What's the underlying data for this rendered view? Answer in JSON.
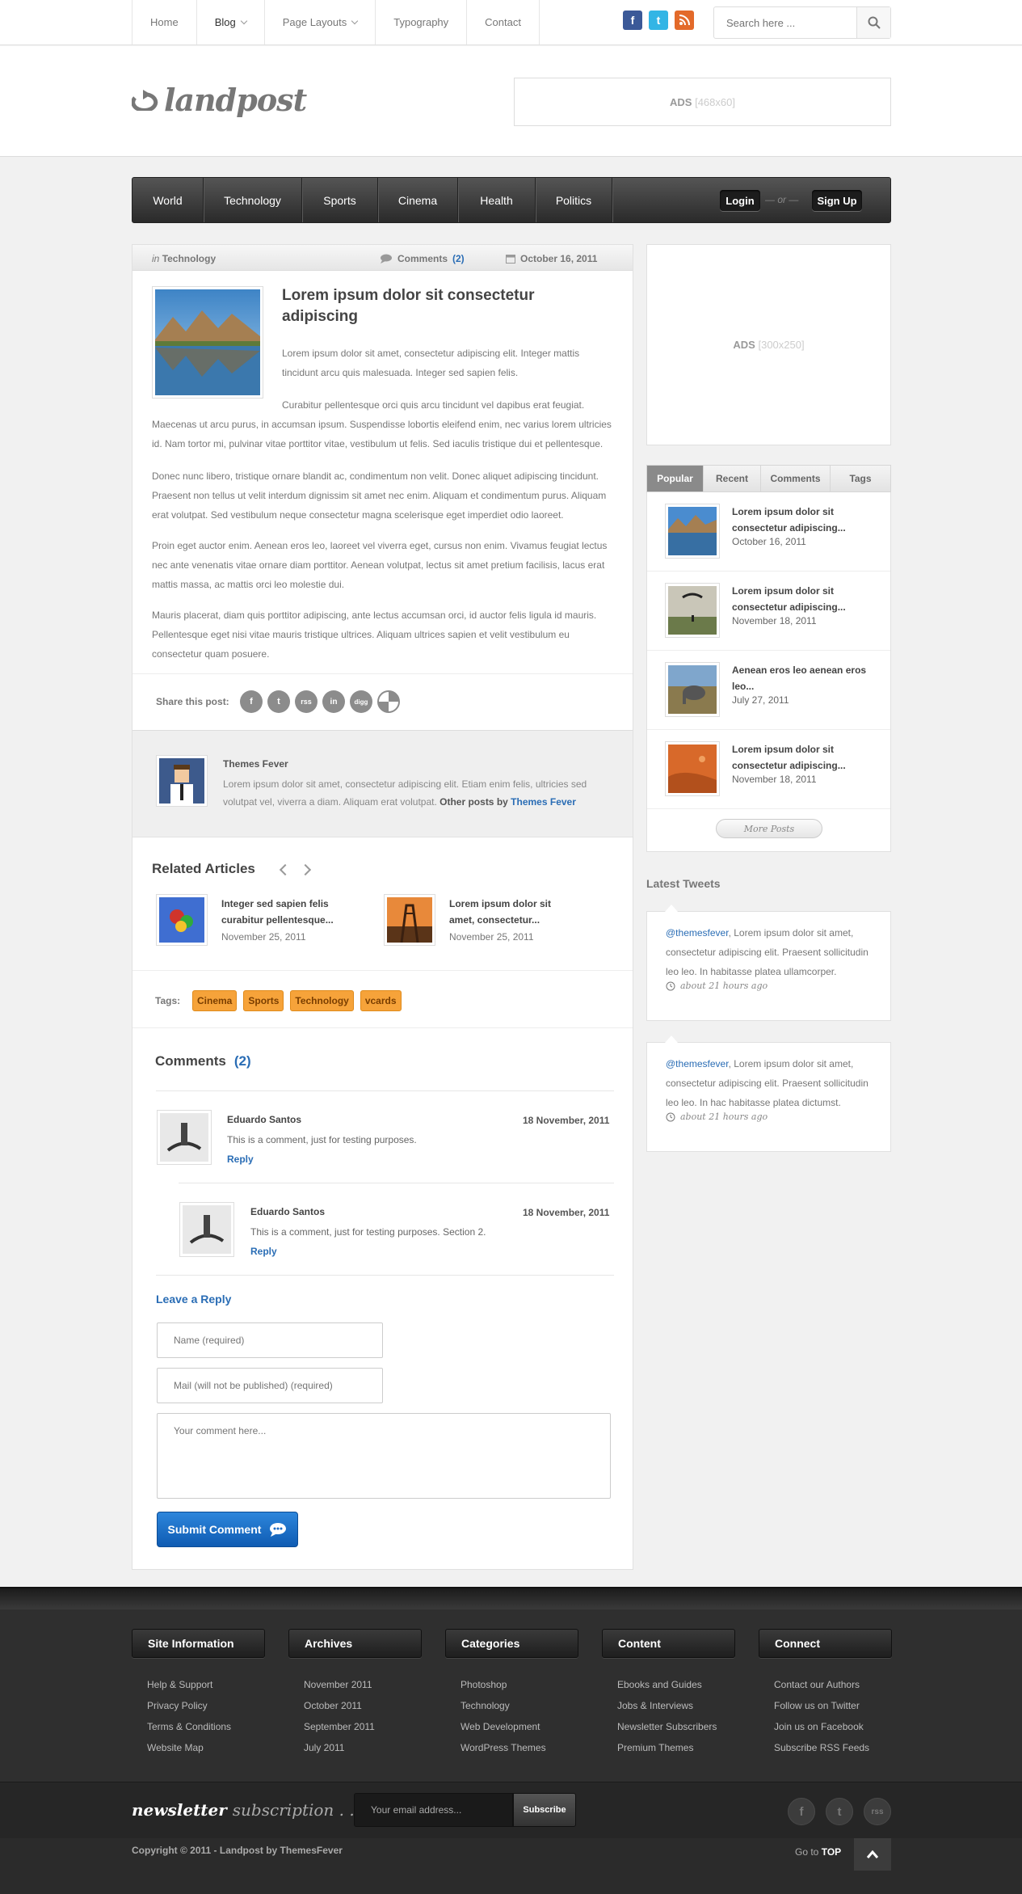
{
  "topnav": {
    "items": [
      "Home",
      "Blog",
      "Page Layouts",
      "Typography",
      "Contact"
    ],
    "social": [
      "facebook-icon",
      "twitter-icon",
      "rss-icon"
    ],
    "search_placeholder": "Search here ..."
  },
  "header": {
    "logo_text": "landpost",
    "ads_label": "ADS",
    "ads_size": "[468x60]"
  },
  "mainnav": {
    "items": [
      "World",
      "Technology",
      "Sports",
      "Cinema",
      "Health",
      "Politics"
    ],
    "login": "Login",
    "or": "— or —",
    "signup": "Sign Up"
  },
  "post": {
    "in_label": "in",
    "category": "Technology",
    "comments_label": "Comments",
    "comments_count": "(2)",
    "date": "October 16, 2011",
    "title": "Lorem ipsum dolor sit consectetur adipiscing",
    "intro": "Lorem ipsum dolor sit amet, consectetur adipiscing elit. Integer mattis tincidunt arcu quis malesuada. Integer sed sapien felis.",
    "p1_first": "Curabitur pellentesque orci quis arcu tincidunt vel dapibus erat feugiat.",
    "p1_rest": "Maecenas ut arcu purus, in accumsan ipsum. Suspendisse lobortis eleifend enim, nec varius lorem ultricies id. Nam tortor mi, pulvinar vitae porttitor vitae, vestibulum ut felis. Sed iaculis tristique dui et pellentesque.",
    "p2": "Donec nunc libero, tristique ornare blandit ac, condimentum non velit. Donec aliquet adipiscing tincidunt. Praesent non tellus ut velit interdum dignissim sit amet nec enim. Aliquam et condimentum purus. Aliquam erat volutpat. Sed vestibulum neque consectetur magna scelerisque eget imperdiet odio laoreet.",
    "p3": "Proin eget auctor enim. Aenean eros leo, laoreet vel viverra eget, cursus non enim. Vivamus feugiat lectus nec ante venenatis vitae ornare diam porttitor. Aenean volutpat, lectus sit amet pretium facilisis, lacus erat mattis massa, ac mattis orci leo molestie dui.",
    "p4": "Mauris placerat, diam quis porttitor adipiscing, ante lectus accumsan orci, id auctor felis ligula id mauris. Pellentesque eget nisi vitae mauris tristique ultrices. Aliquam ultrices sapien et velit vestibulum eu consectetur quam posuere.",
    "share_label": "Share this post:",
    "share_icons": [
      "f",
      "t",
      "rss",
      "in",
      "digg",
      "del"
    ]
  },
  "author": {
    "name": "Themes Fever",
    "bio": "Lorem ipsum dolor sit amet, consectetur adipiscing elit. Etiam enim felis, ultricies sed volutpat vel, viverra a diam. Aliquam erat volutpat.",
    "other_posts": "Other posts by",
    "link": "Themes Fever"
  },
  "related": {
    "title": "Related Articles",
    "items": [
      {
        "title": "Integer sed sapien felis curabitur pellentesque...",
        "date": "November 25, 2011"
      },
      {
        "title": "Lorem ipsum dolor sit amet, consectetur...",
        "date": "November 25, 2011"
      }
    ]
  },
  "tags": {
    "label": "Tags:",
    "items": [
      "Cinema",
      "Sports",
      "Technology",
      "vcards"
    ]
  },
  "comments": {
    "title": "Comments",
    "count": "(2)",
    "items": [
      {
        "name": "Eduardo Santos",
        "date": "18 November, 2011",
        "text": "This is a comment, just for testing purposes.",
        "reply": "Reply"
      },
      {
        "name": "Eduardo Santos",
        "date": "18 November, 2011",
        "text": "This is a comment, just for testing purposes. Section 2.",
        "reply": "Reply"
      }
    ]
  },
  "reply_form": {
    "title": "Leave a Reply",
    "name_placeholder": "Name (required)",
    "mail_placeholder": "Mail (will not be published) (required)",
    "comment_placeholder": "Your comment here...",
    "submit": "Submit Comment"
  },
  "sidebar": {
    "ads_label": "ADS",
    "ads_size": "[300x250]",
    "tabs": [
      "Popular",
      "Recent",
      "Comments",
      "Tags"
    ],
    "posts": [
      {
        "title": "Lorem ipsum dolor sit consectetur adipiscing...",
        "date": "October 16, 2011"
      },
      {
        "title": "Lorem ipsum dolor sit consectetur adipiscing...",
        "date": "November 18, 2011"
      },
      {
        "title": "Aenean eros leo aenean eros leo...",
        "date": "July 27, 2011"
      },
      {
        "title": "Lorem ipsum dolor sit consectetur adipiscing...",
        "date": "November 18, 2011"
      }
    ],
    "more": "More Posts",
    "tweets_title": "Latest Tweets",
    "tweets": [
      {
        "handle": "@themesfever",
        "text": ", Lorem ipsum dolor sit amet, consectetur adipiscing elit. Praesent sollicitudin leo leo. In habitasse platea ullamcorper.",
        "time": "about 21 hours ago"
      },
      {
        "handle": "@themesfever",
        "text": ", Lorem ipsum dolor sit amet, consectetur adipiscing elit. Praesent sollicitudin leo leo. In hac habitasse platea dictumst.",
        "time": "about 21 hours ago"
      }
    ]
  },
  "footer": {
    "cols": [
      {
        "title": "Site Information",
        "links": [
          "Help & Support",
          "Privacy Policy",
          "Terms & Conditions",
          "Website Map"
        ]
      },
      {
        "title": "Archives",
        "links": [
          "November 2011",
          "October 2011",
          "September 2011",
          "July 2011"
        ]
      },
      {
        "title": "Categories",
        "links": [
          "Photoshop",
          "Technology",
          "Web Development",
          "WordPress Themes"
        ]
      },
      {
        "title": "Content",
        "links": [
          "Ebooks and Guides",
          "Jobs & Interviews",
          "Newsletter Subscribers",
          "Premium Themes"
        ]
      },
      {
        "title": "Connect",
        "links": [
          "Contact our Authors",
          "Follow us on Twitter",
          "Join us on Facebook",
          "Subscribe RSS Feeds"
        ]
      }
    ],
    "newsletter_word": "newsletter",
    "newsletter_sub": "subscription . . .",
    "email_placeholder": "Your email address...",
    "subscribe": "Subscribe",
    "social": [
      "f",
      "t",
      "rss"
    ],
    "copyright": "Copyright © 2011 - Landpost by ThemesFever",
    "goto": "Go to",
    "top": "TOP"
  },
  "colors": {
    "accent": "#2a6db5",
    "tag": "#f6a33a",
    "nav": "#333333"
  }
}
